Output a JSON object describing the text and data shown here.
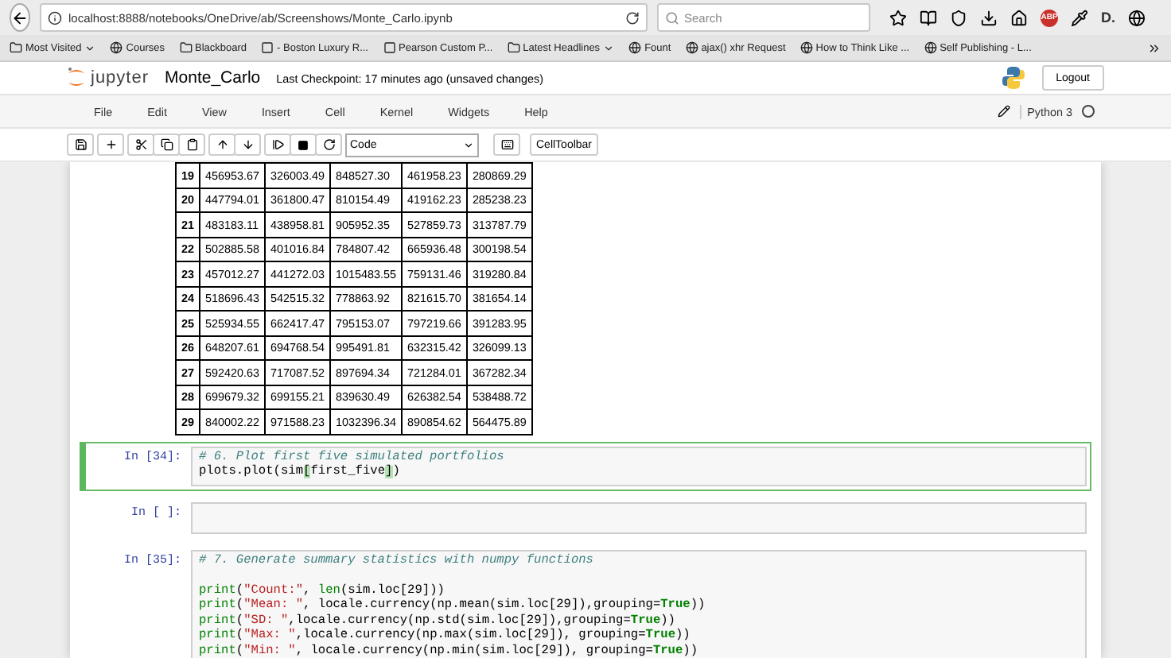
{
  "browser": {
    "url": "localhost:8888/notebooks/OneDrive/ab/Screenshows/Monte_Carlo.ipynb",
    "search_placeholder": "Search",
    "abp_badge": "ABP",
    "d_badge": "D.",
    "bookmarks": [
      {
        "label": "Most Visited",
        "dropdown": true
      },
      {
        "label": "Courses",
        "dropdown": false
      },
      {
        "label": "Blackboard",
        "dropdown": false
      },
      {
        "label": "- Boston Luxury R...",
        "dropdown": false
      },
      {
        "label": "Pearson Custom P...",
        "dropdown": false
      },
      {
        "label": "Latest Headlines",
        "dropdown": true
      },
      {
        "label": "Fount",
        "dropdown": false
      },
      {
        "label": "ajax() xhr Request",
        "dropdown": false
      },
      {
        "label": "How to Think Like ...",
        "dropdown": false
      },
      {
        "label": "Self Publishing - L...",
        "dropdown": false
      }
    ]
  },
  "header": {
    "logo": "jupyter",
    "title": "Monte_Carlo",
    "checkpoint_label": "Last Checkpoint:",
    "checkpoint": "17 minutes ago (unsaved changes)",
    "logout": "Logout"
  },
  "menu": [
    "File",
    "Edit",
    "View",
    "Insert",
    "Cell",
    "Kernel",
    "Widgets",
    "Help"
  ],
  "kernel": {
    "name": "Python 3",
    "busy": false
  },
  "toolbar": {
    "cell_type": "Code",
    "cell_toolbar": "CellToolbar"
  },
  "table": {
    "rows": [
      {
        "index": "19",
        "values": [
          "456953.67",
          "326003.49",
          "848527.30",
          "461958.23",
          "280869.29"
        ]
      },
      {
        "index": "20",
        "values": [
          "447794.01",
          "361800.47",
          "810154.49",
          "419162.23",
          "285238.23"
        ]
      },
      {
        "index": "21",
        "values": [
          "483183.11",
          "438958.81",
          "905952.35",
          "527859.73",
          "313787.79"
        ]
      },
      {
        "index": "22",
        "values": [
          "502885.58",
          "401016.84",
          "784807.42",
          "665936.48",
          "300198.54"
        ]
      },
      {
        "index": "23",
        "values": [
          "457012.27",
          "441272.03",
          "1015483.55",
          "759131.46",
          "319280.84"
        ]
      },
      {
        "index": "24",
        "values": [
          "518696.43",
          "542515.32",
          "778863.92",
          "821615.70",
          "381654.14"
        ]
      },
      {
        "index": "25",
        "values": [
          "525934.55",
          "662417.47",
          "795153.07",
          "797219.66",
          "391283.95"
        ]
      },
      {
        "index": "26",
        "values": [
          "648207.61",
          "694768.54",
          "995491.81",
          "632315.42",
          "326099.13"
        ]
      },
      {
        "index": "27",
        "values": [
          "592420.63",
          "717087.52",
          "897694.34",
          "721284.01",
          "367282.34"
        ]
      },
      {
        "index": "28",
        "values": [
          "699679.32",
          "699155.21",
          "839630.49",
          "626382.54",
          "538488.72"
        ]
      },
      {
        "index": "29",
        "values": [
          "840002.22",
          "971588.23",
          "1032396.34",
          "890854.62",
          "564475.89"
        ]
      }
    ]
  },
  "cells": [
    {
      "prompt": "In [34]:",
      "selected": true,
      "lines": [
        {
          "tokens": [
            {
              "kind": "comment",
              "text": "# 6. Plot first five simulated portfolios"
            }
          ]
        },
        {
          "tokens": [
            {
              "kind": "plain",
              "text": "plots.plot(sim"
            },
            {
              "kind": "match",
              "text": "["
            },
            {
              "kind": "plain",
              "text": "first_five"
            },
            {
              "kind": "match",
              "text": "]"
            },
            {
              "kind": "plain",
              "text": ")"
            }
          ]
        }
      ]
    },
    {
      "prompt": "In [ ]:",
      "selected": false
    },
    {
      "prompt": "In [35]:",
      "selected": false,
      "lines": [
        {
          "tokens": [
            {
              "kind": "comment",
              "text": "# 7. Generate summary statistics with numpy functions"
            }
          ]
        },
        {
          "spaced": true,
          "tokens": [
            {
              "kind": "builtin",
              "text": "print"
            },
            {
              "kind": "plain",
              "text": "("
            },
            {
              "kind": "string",
              "text": "\"Count:\""
            },
            {
              "kind": "plain",
              "text": ", "
            },
            {
              "kind": "builtin",
              "text": "len"
            },
            {
              "kind": "plain",
              "text": "(sim.loc[29]))"
            }
          ]
        },
        {
          "tokens": [
            {
              "kind": "builtin",
              "text": "print"
            },
            {
              "kind": "plain",
              "text": "("
            },
            {
              "kind": "string",
              "text": "\"Mean: \""
            },
            {
              "kind": "plain",
              "text": ", locale.currency(np.mean(sim.loc[29]),grouping="
            },
            {
              "kind": "keyword",
              "text": "True"
            },
            {
              "kind": "plain",
              "text": "))"
            }
          ]
        },
        {
          "tokens": [
            {
              "kind": "builtin",
              "text": "print"
            },
            {
              "kind": "plain",
              "text": "("
            },
            {
              "kind": "string",
              "text": "\"SD: \""
            },
            {
              "kind": "plain",
              "text": ",locale.currency(np.std(sim.loc[29]),grouping="
            },
            {
              "kind": "keyword",
              "text": "True"
            },
            {
              "kind": "plain",
              "text": "))"
            }
          ]
        },
        {
          "tokens": [
            {
              "kind": "builtin",
              "text": "print"
            },
            {
              "kind": "plain",
              "text": "("
            },
            {
              "kind": "string",
              "text": "\"Max: \""
            },
            {
              "kind": "plain",
              "text": ",locale.currency(np.max(sim.loc[29]), grouping="
            },
            {
              "kind": "keyword",
              "text": "True"
            },
            {
              "kind": "plain",
              "text": "))"
            }
          ]
        },
        {
          "tokens": [
            {
              "kind": "builtin",
              "text": "print"
            },
            {
              "kind": "plain",
              "text": "("
            },
            {
              "kind": "string",
              "text": "\"Min: \""
            },
            {
              "kind": "plain",
              "text": ", locale.currency(np.min(sim.loc[29]), grouping="
            },
            {
              "kind": "keyword",
              "text": "True"
            },
            {
              "kind": "plain",
              "text": "))"
            }
          ]
        }
      ]
    }
  ]
}
